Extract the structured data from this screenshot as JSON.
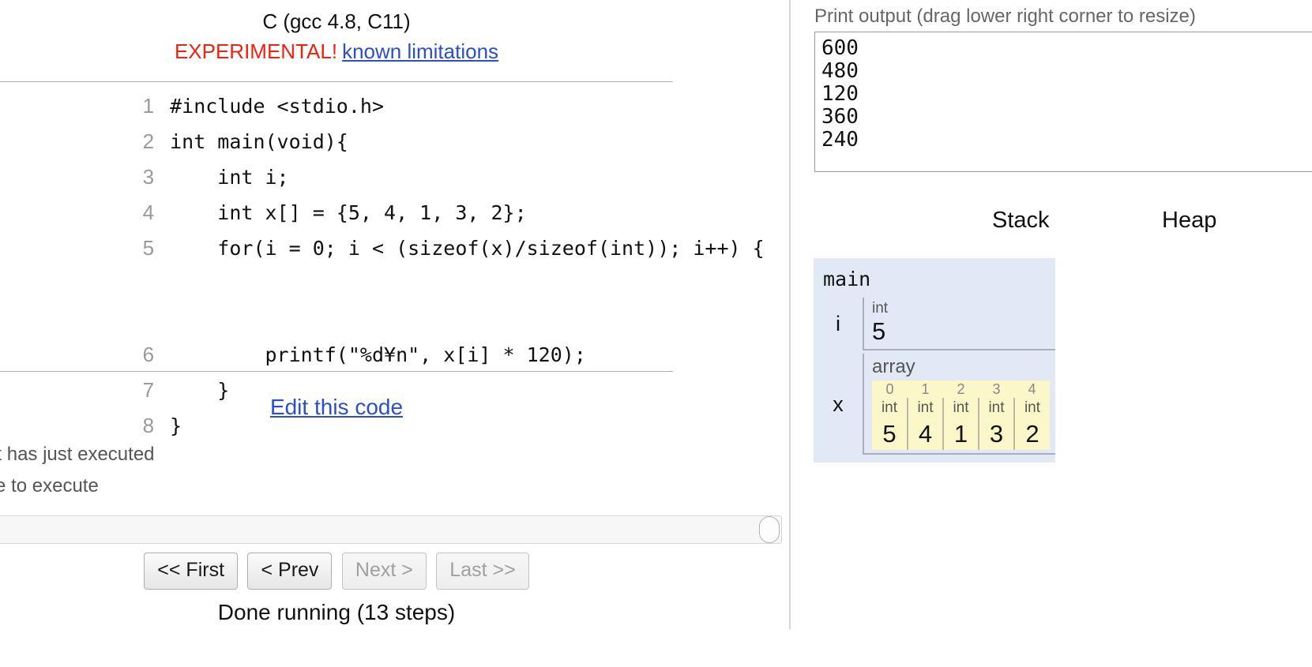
{
  "language_header": {
    "name": "C (gcc 4.8, C11)",
    "experimental_label": "EXPERIMENTAL!",
    "limitations_link": "known limitations"
  },
  "code": {
    "lines": [
      {
        "num": "1",
        "text": "#include <stdio.h>",
        "arrow": "none"
      },
      {
        "num": "2",
        "text": "int main(void){",
        "arrow": "none"
      },
      {
        "num": "3",
        "text": "    int i;",
        "arrow": "none"
      },
      {
        "num": "4",
        "text": "    int x[] = {5, 4, 1, 3, 2};",
        "arrow": "none"
      },
      {
        "num": "5",
        "text": "    for(i = 0; i < (sizeof(x)/sizeof(int)); i++) {",
        "arrow": "green"
      },
      {
        "num": "6",
        "text": "        printf(\"%d¥n\", x[i] * 120);",
        "arrow": "none"
      },
      {
        "num": "7",
        "text": "    }",
        "arrow": "none"
      },
      {
        "num": "8",
        "text": "}",
        "arrow": "red"
      }
    ],
    "edit_link": "Edit this code"
  },
  "legend": {
    "just_executed": "line that has just executed",
    "next_to_execute": "next line to execute"
  },
  "controls": {
    "first_label": "<< First",
    "prev_label": "< Prev",
    "next_label": "Next >",
    "last_label": "Last >>",
    "first_disabled": false,
    "prev_disabled": false,
    "next_disabled": true,
    "last_disabled": true,
    "status": "Done running (13 steps)"
  },
  "print_output": {
    "label": "Print output (drag lower right corner to resize)",
    "text": "600\n480\n120\n360\n240"
  },
  "visualization": {
    "stack_header": "Stack",
    "heap_header": "Heap",
    "frames": [
      {
        "title": "main",
        "variables": [
          {
            "name": "i",
            "kind": "scalar",
            "type": "int",
            "value": "5"
          },
          {
            "name": "x",
            "kind": "array",
            "label": "array",
            "indices": [
              "0",
              "1",
              "2",
              "3",
              "4"
            ],
            "types": [
              "int",
              "int",
              "int",
              "int",
              "int"
            ],
            "values": [
              "5",
              "4",
              "1",
              "3",
              "2"
            ]
          }
        ]
      }
    ]
  },
  "colors": {
    "experimental": "#ee2211",
    "link": "#2b4fc6",
    "frame_bg": "#e2e8f5",
    "array_bg": "#fbf7c8",
    "arrow_green": "#c3e8c3",
    "arrow_red": "#e8442a"
  }
}
